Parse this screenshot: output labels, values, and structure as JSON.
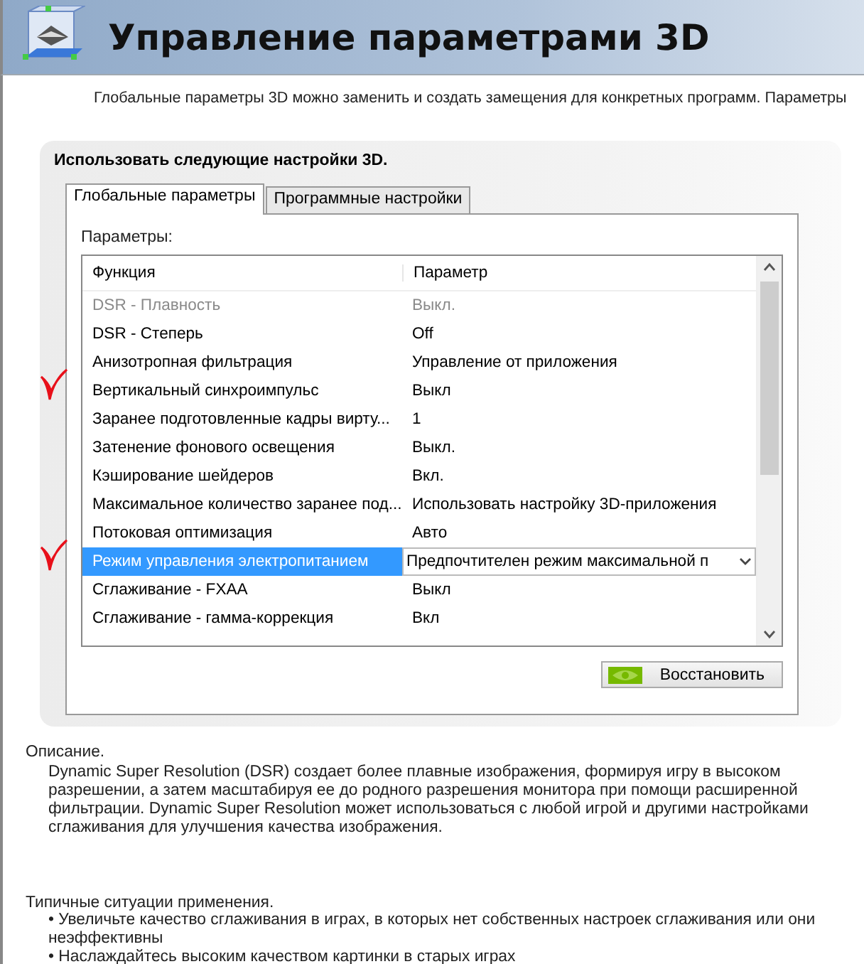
{
  "header": {
    "title": "Управление параметрами 3D"
  },
  "intro": "Глобальные параметры 3D можно заменить и создать замещения для конкретных программ. Параметры",
  "panel": {
    "heading": "Использовать следующие настройки 3D.",
    "tabs": [
      {
        "label": "Глобальные параметры",
        "selected": true
      },
      {
        "label": "Программные настройки",
        "selected": false
      }
    ],
    "list_label": "Параметры:",
    "columns": [
      "Функция",
      "Параметр"
    ],
    "rows": [
      {
        "feature": "DSR - Плавность",
        "value": "Выкл.",
        "disabled": true,
        "selected": false,
        "marked": false
      },
      {
        "feature": "DSR - Степерь",
        "value": "Off",
        "disabled": false,
        "selected": false,
        "marked": false
      },
      {
        "feature": "Анизотропная фильтрация",
        "value": "Управление от приложения",
        "disabled": false,
        "selected": false,
        "marked": false
      },
      {
        "feature": "Вертикальный синхроимпульс",
        "value": "Выкл",
        "disabled": false,
        "selected": false,
        "marked": true
      },
      {
        "feature": "Заранее подготовленные кадры вирту...",
        "value": "1",
        "disabled": false,
        "selected": false,
        "marked": false
      },
      {
        "feature": "Затенение фонового освещения",
        "value": "Выкл.",
        "disabled": false,
        "selected": false,
        "marked": false
      },
      {
        "feature": "Кэширование шейдеров",
        "value": "Вкл.",
        "disabled": false,
        "selected": false,
        "marked": false
      },
      {
        "feature": "Максимальное количество заранее под...",
        "value": "Использовать настройку 3D-приложения",
        "disabled": false,
        "selected": false,
        "marked": false
      },
      {
        "feature": "Потоковая оптимизация",
        "value": "Авто",
        "disabled": false,
        "selected": false,
        "marked": false
      },
      {
        "feature": "Режим управления электропитанием",
        "value": "Предпочтителен режим максимальной п",
        "disabled": false,
        "selected": true,
        "marked": true
      },
      {
        "feature": "Сглаживание - FXAA",
        "value": "Выкл",
        "disabled": false,
        "selected": false,
        "marked": false
      },
      {
        "feature": "Сглаживание - гамма-коррекция",
        "value": "Вкл",
        "disabled": false,
        "selected": false,
        "marked": false
      }
    ],
    "restore_button": "Восстановить"
  },
  "description": {
    "label": "Описание.",
    "text": "Dynamic Super Resolution (DSR) создает более плавные изображения, формируя игру в высоком разрешении, а затем масштабируя ее до родного разрешения монитора при помощи расширенной фильтрации. Dynamic Super Resolution может использоваться с любой игрой и другими настройками сглаживания для улучшения качества изображения."
  },
  "usage": {
    "label": "Типичные ситуации применения.",
    "items": [
      "• Увеличьте качество сглаживания в играх, в которых нет собственных настроек сглаживания или они неэффективны",
      "• Наслаждайтесь высоким качеством картинки в старых играх"
    ]
  }
}
